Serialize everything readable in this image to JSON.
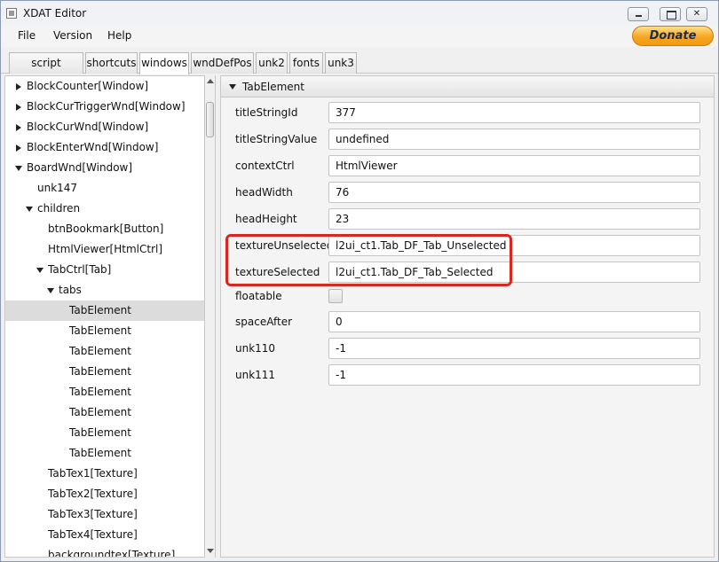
{
  "window": {
    "title": "XDAT Editor"
  },
  "menu": {
    "items": [
      "File",
      "Version",
      "Help"
    ]
  },
  "donate": {
    "label": "Donate"
  },
  "tabs": [
    "script console",
    "shortcuts",
    "windows",
    "wndDefPos",
    "unk2",
    "fonts",
    "unk3"
  ],
  "active_tab": "windows",
  "tree": [
    {
      "label": "BlockCounter[Window]",
      "expander": "collapsed"
    },
    {
      "label": "BlockCurTriggerWnd[Window]",
      "expander": "collapsed"
    },
    {
      "label": "BlockCurWnd[Window]",
      "expander": "collapsed"
    },
    {
      "label": "BlockEnterWnd[Window]",
      "expander": "collapsed"
    },
    {
      "label": "BoardWnd[Window]",
      "expander": "expanded"
    },
    {
      "label": "unk147",
      "expander": "none"
    },
    {
      "label": "children",
      "expander": "expanded"
    },
    {
      "label": "btnBookmark[Button]",
      "expander": "none"
    },
    {
      "label": "HtmlViewer[HtmlCtrl]",
      "expander": "none"
    },
    {
      "label": "TabCtrl[Tab]",
      "expander": "expanded"
    },
    {
      "label": "tabs",
      "expander": "expanded"
    },
    {
      "label": "TabElement",
      "expander": "none",
      "selected": true
    },
    {
      "label": "TabElement",
      "expander": "none"
    },
    {
      "label": "TabElement",
      "expander": "none"
    },
    {
      "label": "TabElement",
      "expander": "none"
    },
    {
      "label": "TabElement",
      "expander": "none"
    },
    {
      "label": "TabElement",
      "expander": "none"
    },
    {
      "label": "TabElement",
      "expander": "none"
    },
    {
      "label": "TabElement",
      "expander": "none"
    },
    {
      "label": "TabTex1[Texture]",
      "expander": "none"
    },
    {
      "label": "TabTex2[Texture]",
      "expander": "none"
    },
    {
      "label": "TabTex3[Texture]",
      "expander": "none"
    },
    {
      "label": "TabTex4[Texture]",
      "expander": "none"
    },
    {
      "label": "backgroundtex[Texture]",
      "expander": "none"
    }
  ],
  "properties": {
    "section_title": "TabElement",
    "rows": [
      {
        "label": "titleStringId",
        "type": "text",
        "value": "377"
      },
      {
        "label": "titleStringValue",
        "type": "text",
        "value": "undefined"
      },
      {
        "label": "contextCtrl",
        "type": "text",
        "value": "HtmlViewer"
      },
      {
        "label": "headWidth",
        "type": "text",
        "value": "76"
      },
      {
        "label": "headHeight",
        "type": "text",
        "value": "23"
      },
      {
        "label": "textureUnselected",
        "type": "text",
        "value": "l2ui_ct1.Tab_DF_Tab_Unselected"
      },
      {
        "label": "textureSelected",
        "type": "text",
        "value": "l2ui_ct1.Tab_DF_Tab_Selected"
      },
      {
        "label": "floatable",
        "type": "checkbox",
        "checked": false
      },
      {
        "label": "spaceAfter",
        "type": "text",
        "value": "0"
      },
      {
        "label": "unk110",
        "type": "text",
        "value": "-1"
      },
      {
        "label": "unk111",
        "type": "text",
        "value": "-1"
      }
    ]
  },
  "colors": {
    "highlight": "#d6281f",
    "selection": "#dcdcdc",
    "donate": "#f6a623"
  }
}
